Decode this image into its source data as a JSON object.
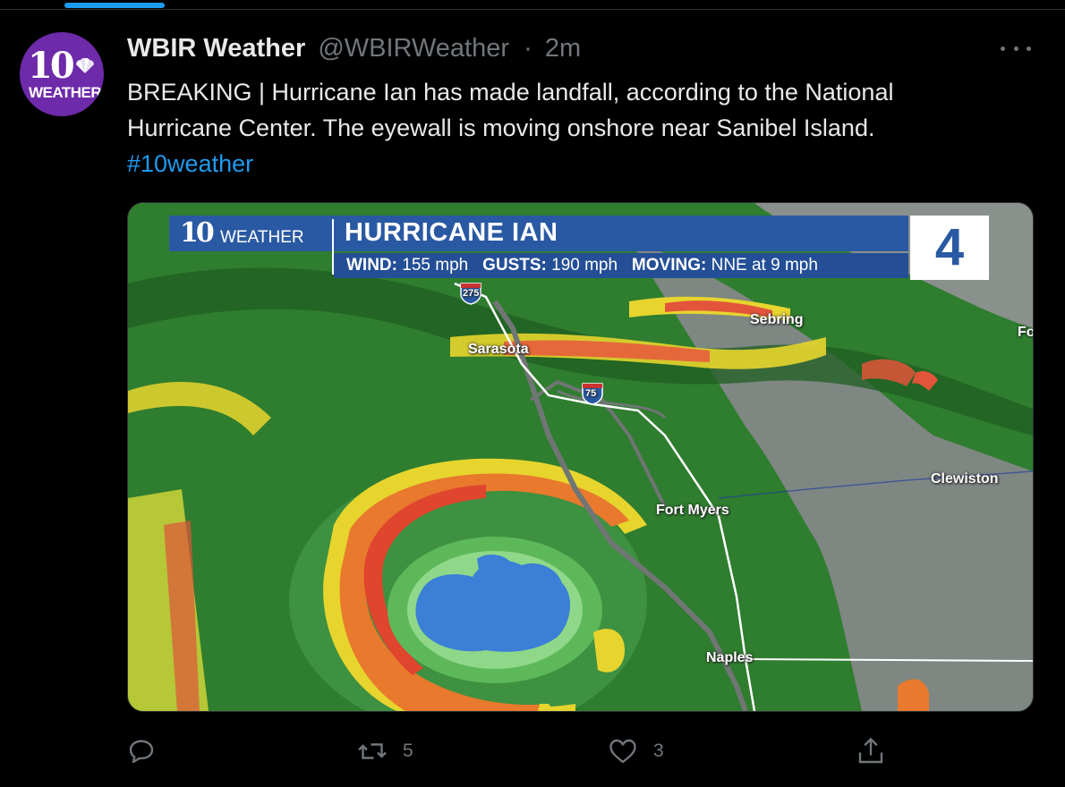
{
  "tweet": {
    "author_name": "WBIR Weather",
    "handle": "@WBIRWeather",
    "separator": "·",
    "time": "2m",
    "text_line1": "BREAKING | Hurricane Ian has made landfall, according to the National",
    "text_line2": "Hurricane Center. The eyewall is moving onshore near Sanibel Island.",
    "hashtag": "#10weather",
    "avatar": {
      "number": "10",
      "label": "WEATHER",
      "color": "#6d2aa9"
    }
  },
  "media": {
    "logo_number": "10",
    "logo_text": "WEATHER",
    "storm_name": "HURRICANE IAN",
    "wind_label": "WIND:",
    "wind_value": "155 mph",
    "gusts_label": "GUSTS:",
    "gusts_value": "190 mph",
    "moving_label": "MOVING:",
    "moving_value": "NNE at 9 mph",
    "category": "4",
    "cities": [
      "Sebring",
      "Sarasota",
      "Fort Myers",
      "Clewiston",
      "Naples",
      "Fo"
    ],
    "highways": [
      "275",
      "75"
    ]
  },
  "actions": {
    "reply_count": "",
    "retweet_count": "5",
    "like_count": "3"
  },
  "colors": {
    "link": "#1d9bf0",
    "muted": "#71767b",
    "banner_blue": "#2a59a3"
  }
}
